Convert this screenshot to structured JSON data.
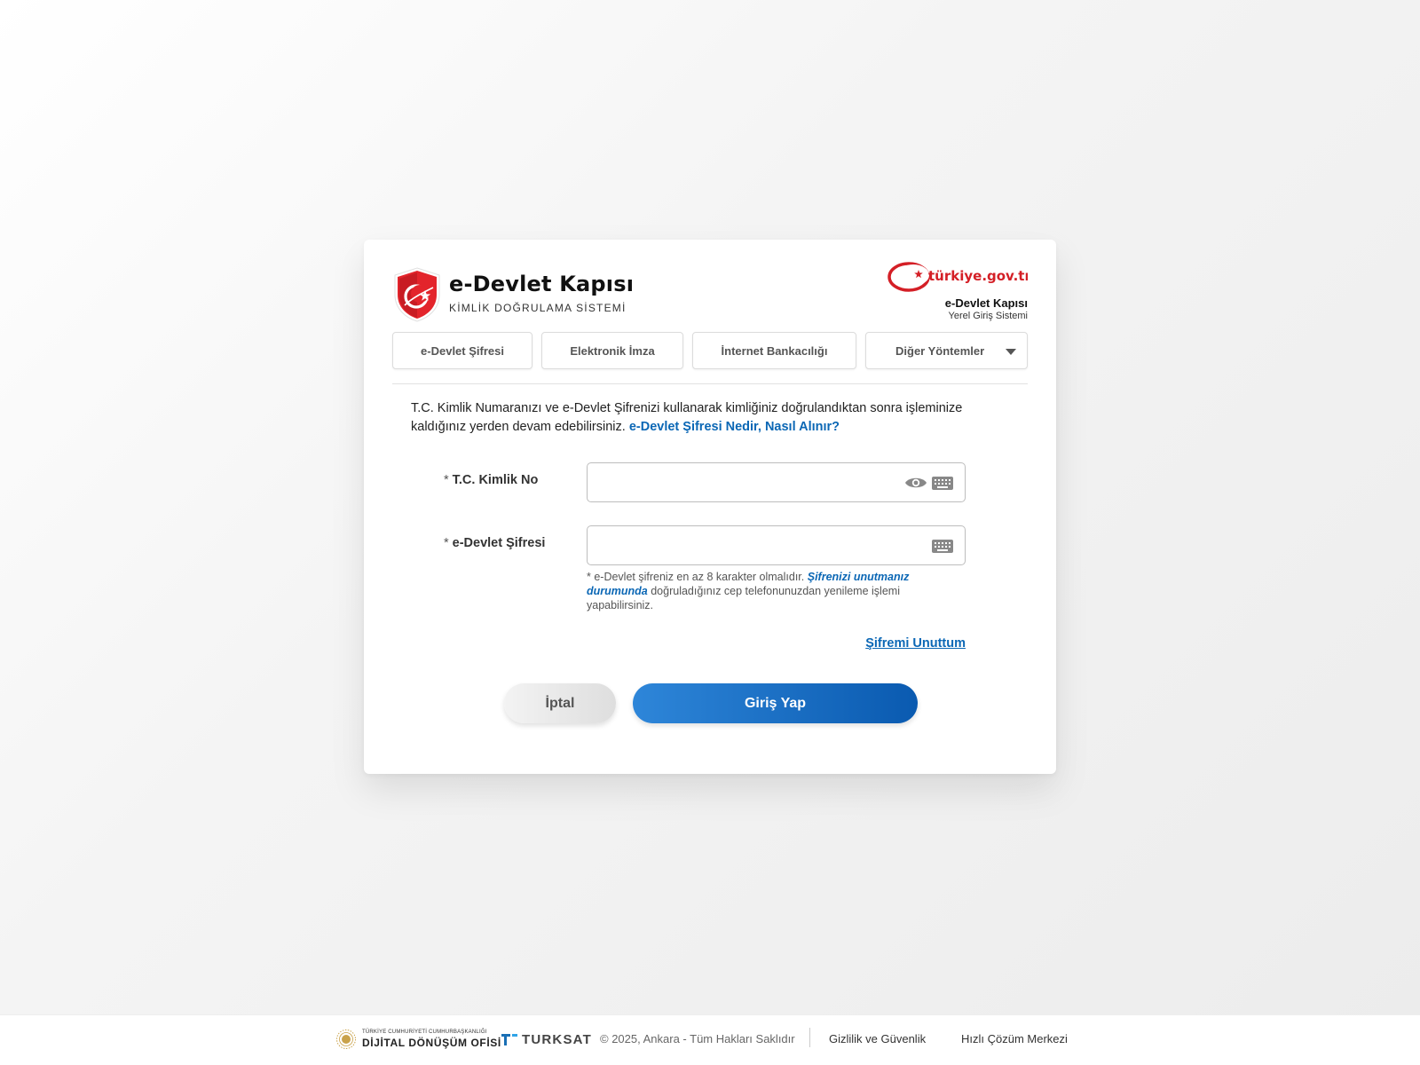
{
  "brand": {
    "title": "e-Devlet Kapısı",
    "subtitle": "KİMLİK DOĞRULAMA SİSTEMİ",
    "logo_icon": "shield-crescent-star-icon",
    "primary_color": "#e3242b"
  },
  "portal": {
    "logo_text": "türkiye.gov.tr",
    "title": "e-Devlet Kapısı",
    "subtitle": "Yerel Giriş Sistemi"
  },
  "tabs": [
    {
      "label": "e-Devlet Şifresi"
    },
    {
      "label": "Elektronik İmza"
    },
    {
      "label": "İnternet Bankacılığı"
    },
    {
      "label": "Diğer Yöntemler"
    }
  ],
  "intro": {
    "text": "T.C. Kimlik Numaranızı ve e-Devlet Şifrenizi kullanarak kimliğiniz doğrulandıktan sonra işleminize kaldığınız yerden devam edebilirsiniz.",
    "link": "e-Devlet Şifresi Nedir, Nasıl Alınır?"
  },
  "form": {
    "required_mark": "*",
    "tc_label": "T.C. Kimlik No",
    "tc_value": "",
    "password_label": "e-Devlet Şifresi",
    "password_value": "",
    "hint_prefix": "* e-Devlet şifreniz en az 8 karakter olmalıdır.",
    "hint_emphasis": "Şifrenizi unutmanız durumunda",
    "hint_suffix": "doğruladığınız cep telefonunuzdan yenileme işlemi yapabilirsiniz.",
    "forgot_link": "Şifremi Unuttum"
  },
  "buttons": {
    "cancel": "İptal",
    "login": "Giriş Yap"
  },
  "colors": {
    "link": "#0b67b5",
    "login_button": "#1a6fc6"
  },
  "footer": {
    "ddo_small": "TÜRKİYE CUMHURİYETİ CUMHURBAŞKANLIĞI",
    "ddo_name": "DİJİTAL DÖNÜŞÜM OFİSİ",
    "turksat": "TURKSAT",
    "copyright": "© 2025, Ankara - Tüm Hakları Saklıdır",
    "links": [
      "Gizlilik ve Güvenlik",
      "Hızlı Çözüm Merkezi"
    ]
  }
}
